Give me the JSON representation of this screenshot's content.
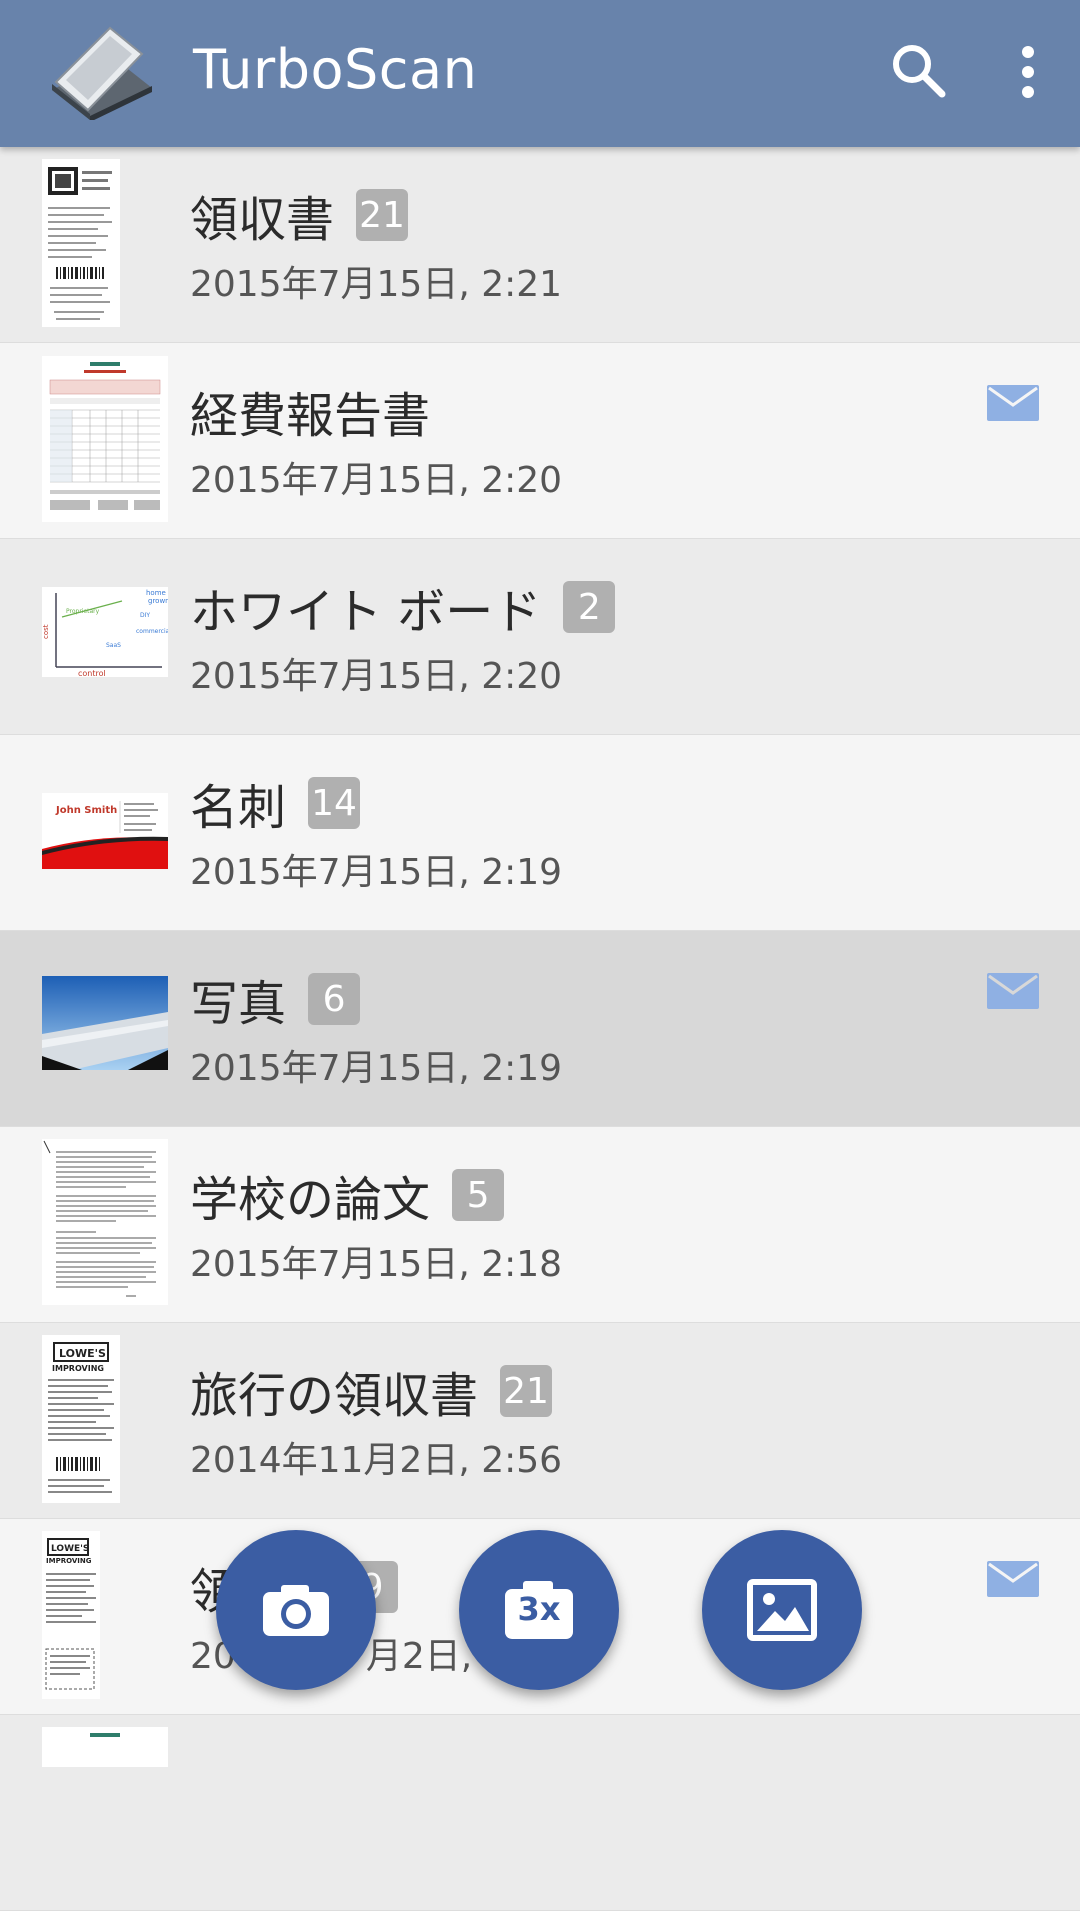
{
  "app": {
    "title": "TurboScan",
    "icons": [
      "scanner-logo-icon",
      "search-icon",
      "more-vert-icon"
    ]
  },
  "documents": [
    {
      "name": "領収書",
      "count": "21",
      "date": "2015年7月15日, 2:21",
      "mailed": false,
      "thumb": "receipt"
    },
    {
      "name": "経費報告書",
      "count": "",
      "date": "2015年7月15日, 2:20",
      "mailed": true,
      "thumb": "expense-report"
    },
    {
      "name": "ホワイト ボード",
      "count": "2",
      "date": "2015年7月15日, 2:20",
      "mailed": false,
      "thumb": "whiteboard"
    },
    {
      "name": "名刺",
      "count": "14",
      "date": "2015年7月15日, 2:19",
      "mailed": false,
      "thumb": "business-card"
    },
    {
      "name": "写真",
      "count": "6",
      "date": "2015年7月15日, 2:19",
      "mailed": true,
      "thumb": "photo"
    },
    {
      "name": "学校の論文",
      "count": "5",
      "date": "2015年7月15日, 2:18",
      "mailed": false,
      "thumb": "paper"
    },
    {
      "name": "旅行の領収書",
      "count": "21",
      "date": "2014年11月2日, 2:56",
      "mailed": false,
      "thumb": "receipt-lowes"
    },
    {
      "name": "領",
      "count": "9",
      "date": "20",
      "date_tail": "月2日, 2",
      "mailed": true,
      "thumb": "receipt-lowes"
    }
  ],
  "fabs": [
    {
      "name": "camera-button",
      "label": ""
    },
    {
      "name": "batch-3x-button",
      "label": "3x"
    },
    {
      "name": "gallery-button",
      "label": ""
    }
  ],
  "colors": {
    "appbar": "#6883ab",
    "fab": "#3b5da3",
    "badge": "#b0b0b0",
    "mail": "#8fb0e3",
    "selected_row": "#d8d8d8"
  }
}
